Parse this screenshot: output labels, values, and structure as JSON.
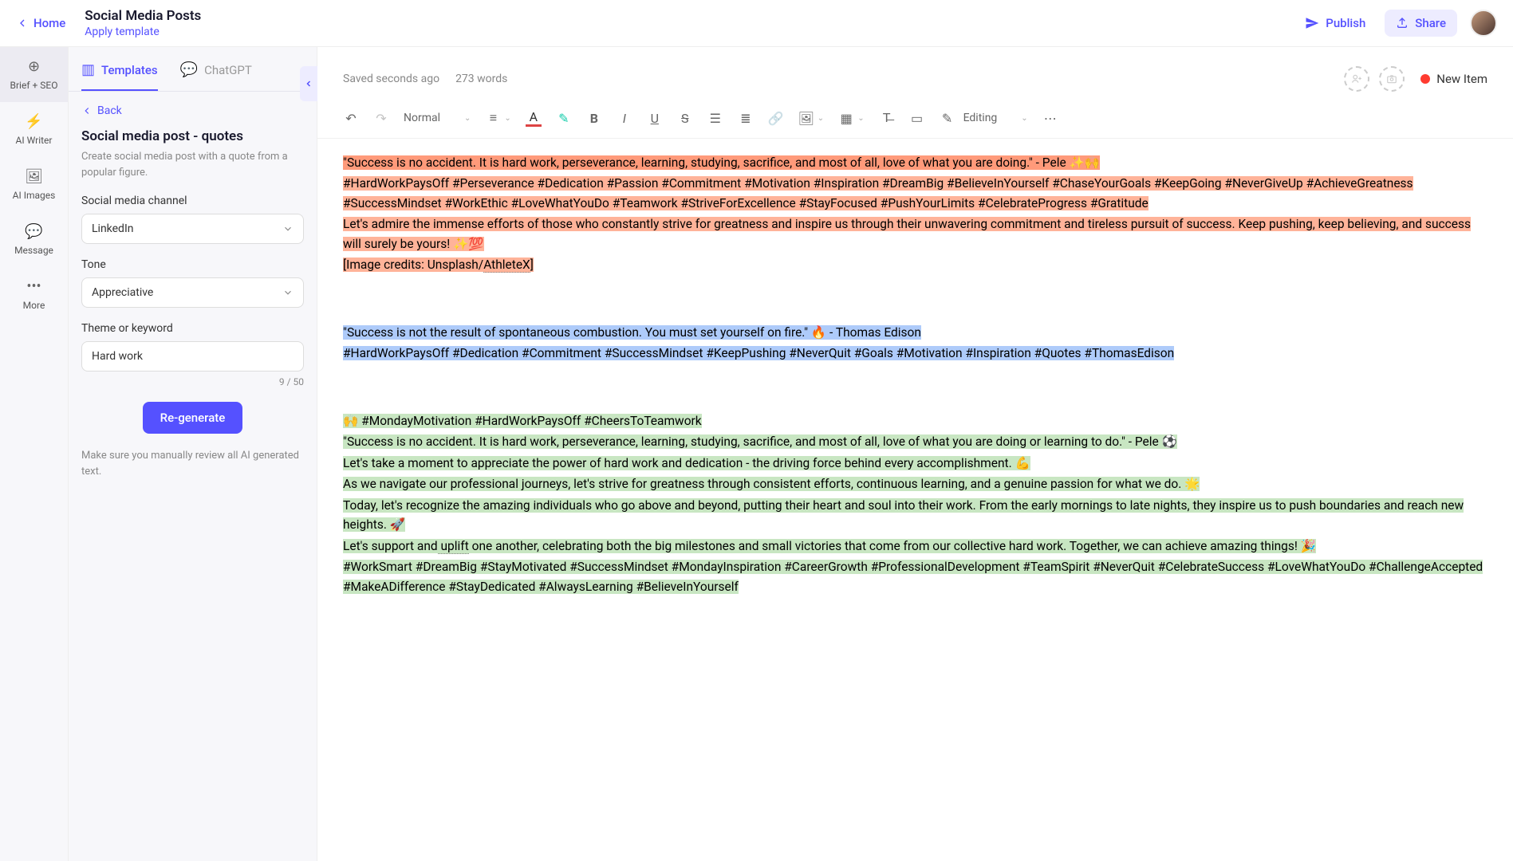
{
  "header": {
    "home": "Home",
    "title": "Social Media Posts",
    "applyTemplate": "Apply template",
    "publish": "Publish",
    "share": "Share"
  },
  "rail": {
    "brief": "Brief + SEO",
    "writer": "AI Writer",
    "images": "AI Images",
    "message": "Message",
    "more": "More"
  },
  "tabs": {
    "templates": "Templates",
    "chatgpt": "ChatGPT"
  },
  "panel": {
    "back": "Back",
    "heading": "Social media post - quotes",
    "desc": "Create social media post with a quote from a popular figure.",
    "channelLabel": "Social media channel",
    "channelValue": "LinkedIn",
    "toneLabel": "Tone",
    "toneValue": "Appreciative",
    "themeLabel": "Theme or keyword",
    "themeValue": "Hard work",
    "charCount": "9 / 50",
    "regenerate": "Re-generate",
    "note": "Make sure you manually review all AI generated text."
  },
  "editorHeader": {
    "saved": "Saved seconds ago",
    "wordCount": "273 words",
    "status": "New Item"
  },
  "toolbar": {
    "normal": "Normal",
    "editing": "Editing"
  },
  "content": {
    "p1": "\"Success is no accident. It is hard work, perseverance, learning, studying, sacrifice, and most of all, love of what you are doing.\" - Pele ✨🙌",
    "p2": "#HardWorkPaysOff #Perseverance #Dedication #Passion #Commitment #Motivation #Inspiration #DreamBig #BelieveInYourself #ChaseYourGoals #KeepGoing #NeverGiveUp #AchieveGreatness #SuccessMindset #WorkEthic #LoveWhatYouDo #Teamwork #StriveForExcellence #StayFocused #PushYourLimits #CelebrateProgress #Gratitude",
    "p3": "Let's admire the immense efforts of those who constantly strive for greatness and inspire us through their unwavering commitment and tireless pursuit of success. Keep pushing, keep believing, and success will surely be yours! ✨💯",
    "p4a": "[Image credits: Unsplash/",
    "p4b": "AthleteX",
    "p4c": "]",
    "p5": "\"Success is not the result of spontaneous combustion. You must set yourself on fire.\" 🔥 - Thomas Edison",
    "p6": "#HardWorkPaysOff #Dedication #Commitment #SuccessMindset #KeepPushing #NeverQuit #Goals #Motivation #Inspiration #Quotes #ThomasEdison",
    "p7": "🙌 #MondayMotivation #HardWorkPaysOff #CheersToTeamwork",
    "p8": "\"Success is no accident. It is hard work, perseverance, learning, studying, sacrifice, and most of all, love of what you are doing or learning to do.\" - Pele ⚽",
    "p9": "Let's take a moment to appreciate the power of hard work and dedication - the driving force behind every accomplishment. 💪",
    "p10": "As we navigate our professional journeys, let's strive for greatness through consistent efforts, continuous learning, and a genuine passion for what we do. 🌟",
    "p11": "Today, let's recognize the amazing individuals who go above and beyond, putting their heart and soul into their work. From the early mornings to late nights, they inspire us to push boundaries and reach new heights. 🚀",
    "p12a": "Let's support and",
    "p12b": " uplift",
    "p12c": " one another, celebrating both the big milestones and small victories that come from our collective hard work. Together, we can achieve amazing things! 🎉",
    "p13": "#WorkSmart #DreamBig #StayMotivated #SuccessMindset #MondayInspiration #CareerGrowth #ProfessionalDevelopment #TeamSpirit #NeverQuit #CelebrateSuccess #LoveWhatYouDo #ChallengeAccepted #MakeADifference #StayDedicated #AlwaysLearning #BelieveInYourself"
  }
}
